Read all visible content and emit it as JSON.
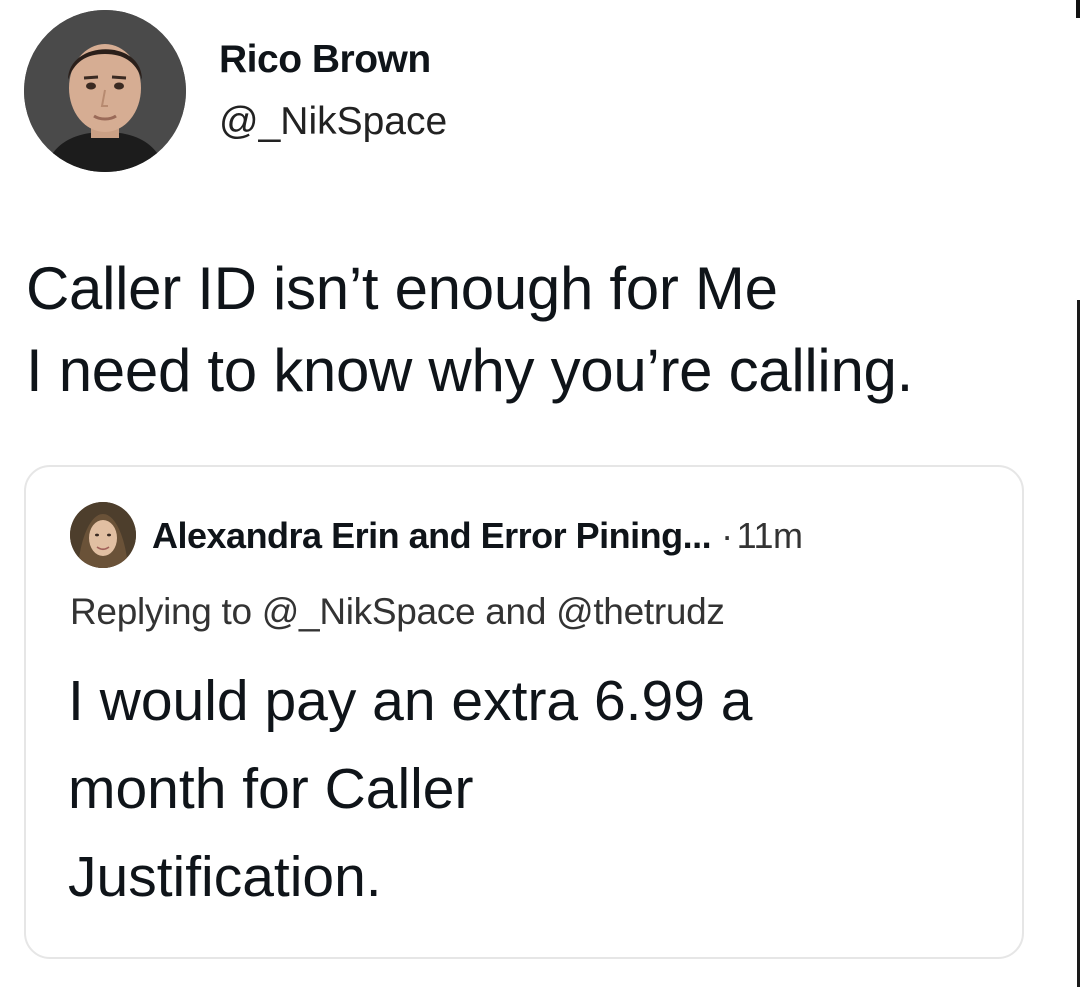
{
  "tweet": {
    "author": {
      "display_name": "Rico Brown",
      "handle": "@_NikSpace",
      "avatar_icon": "user-avatar-photo"
    },
    "text_lines": [
      "Caller ID isn’t enough for Me",
      "I need to know why you’re calling."
    ]
  },
  "quote": {
    "author": {
      "display_name": "Alexandra Erin and Error Pining...",
      "avatar_icon": "user-avatar-photo"
    },
    "separator": "·",
    "time": "11m",
    "replying_to": "Replying to @_NikSpace and @thetrudz",
    "text_lines": [
      "I would pay an extra 6.99 a",
      "month for Caller",
      "Justification."
    ]
  },
  "colors": {
    "text": "#0f1419",
    "secondary_text": "#333333",
    "card_border": "#e6e6e6",
    "background": "#ffffff"
  }
}
